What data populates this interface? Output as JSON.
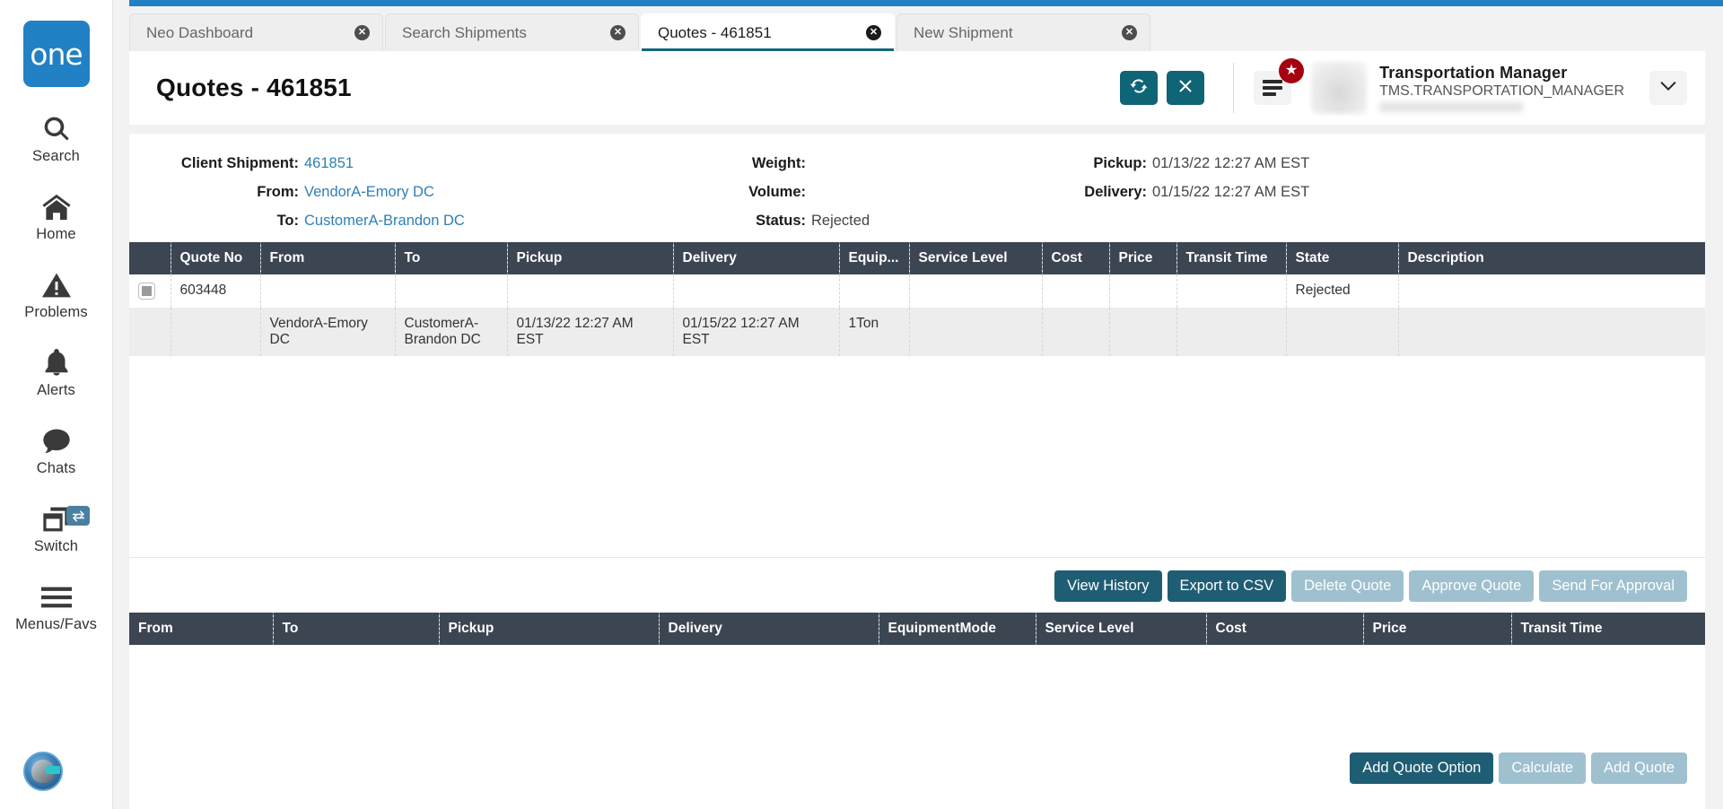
{
  "brand": {
    "logo_text": "one",
    "accent_blue": "#2280c4",
    "teal": "#0f6476",
    "header_dark": "#3c4552"
  },
  "sidebar": {
    "items": [
      {
        "label": "Search",
        "icon": "search-icon"
      },
      {
        "label": "Home",
        "icon": "home-icon"
      },
      {
        "label": "Problems",
        "icon": "warning-triangle-icon"
      },
      {
        "label": "Alerts",
        "icon": "bell-icon"
      },
      {
        "label": "Chats",
        "icon": "chat-bubble-icon"
      },
      {
        "label": "Switch",
        "icon": "windows-stack-icon",
        "badge_icon": "swap-arrows-icon"
      },
      {
        "label": "Menus/Favs",
        "icon": "hamburger-icon"
      }
    ],
    "bot_avatar": "robot-head-avatar-icon"
  },
  "tabs": [
    {
      "label": "Neo Dashboard",
      "active": false
    },
    {
      "label": "Search Shipments",
      "active": false
    },
    {
      "label": "Quotes - 461851",
      "active": true
    },
    {
      "label": "New Shipment",
      "active": false
    }
  ],
  "header": {
    "title": "Quotes - 461851",
    "refresh_icon": "refresh-icon",
    "close_icon": "close-x-icon",
    "menu_icon": "hamburger-menu-icon",
    "star_badge": "★",
    "chevron_icon": "chevron-down-icon",
    "user": {
      "name": "Transportation Manager",
      "role": "TMS.TRANSPORTATION_MANAGER"
    }
  },
  "details": {
    "col1": [
      {
        "label": "Client Shipment:",
        "value": "461851",
        "link": true
      },
      {
        "label": "From:",
        "value": "VendorA-Emory DC",
        "link": true
      },
      {
        "label": "To:",
        "value": "CustomerA-Brandon DC",
        "link": true
      }
    ],
    "col2": [
      {
        "label": "Weight:",
        "value": ""
      },
      {
        "label": "Volume:",
        "value": ""
      },
      {
        "label": "Status:",
        "value": "Rejected"
      }
    ],
    "col3": [
      {
        "label": "Pickup:",
        "value": "01/13/22 12:27 AM EST"
      },
      {
        "label": "Delivery:",
        "value": "01/15/22 12:27 AM EST"
      }
    ]
  },
  "quotes_table": {
    "columns": [
      "Quote No",
      "From",
      "To",
      "Pickup",
      "Delivery",
      "Equip...",
      "Service Level",
      "Cost",
      "Price",
      "Transit Time",
      "State",
      "Description"
    ],
    "rows": [
      {
        "checkbox": true,
        "quote_no": "603448",
        "from": "",
        "to": "",
        "pickup": "",
        "delivery": "",
        "equipment": "",
        "service_level": "",
        "cost": "",
        "price": "",
        "transit_time": "",
        "state": "Rejected",
        "description": ""
      },
      {
        "checkbox": false,
        "quote_no": "",
        "from": "VendorA-Emory DC",
        "to": "CustomerA-Brandon DC",
        "pickup": "01/13/22 12:27 AM EST",
        "delivery": "01/15/22 12:27 AM EST",
        "equipment": "1Ton",
        "service_level": "",
        "cost": "",
        "price": "",
        "transit_time": "",
        "state": "",
        "description": ""
      }
    ]
  },
  "quote_actions": [
    {
      "label": "View History",
      "style": "primary"
    },
    {
      "label": "Export to CSV",
      "style": "primary"
    },
    {
      "label": "Delete Quote",
      "style": "muted"
    },
    {
      "label": "Approve Quote",
      "style": "muted"
    },
    {
      "label": "Send For Approval",
      "style": "muted"
    }
  ],
  "options_table": {
    "columns": [
      "From",
      "To",
      "Pickup",
      "Delivery",
      "EquipmentMode",
      "Service Level",
      "Cost",
      "Price",
      "Transit Time"
    ],
    "rows": []
  },
  "option_actions": [
    {
      "label": "Add Quote Option",
      "style": "primary"
    },
    {
      "label": "Calculate",
      "style": "muted"
    },
    {
      "label": "Add Quote",
      "style": "muted"
    }
  ]
}
